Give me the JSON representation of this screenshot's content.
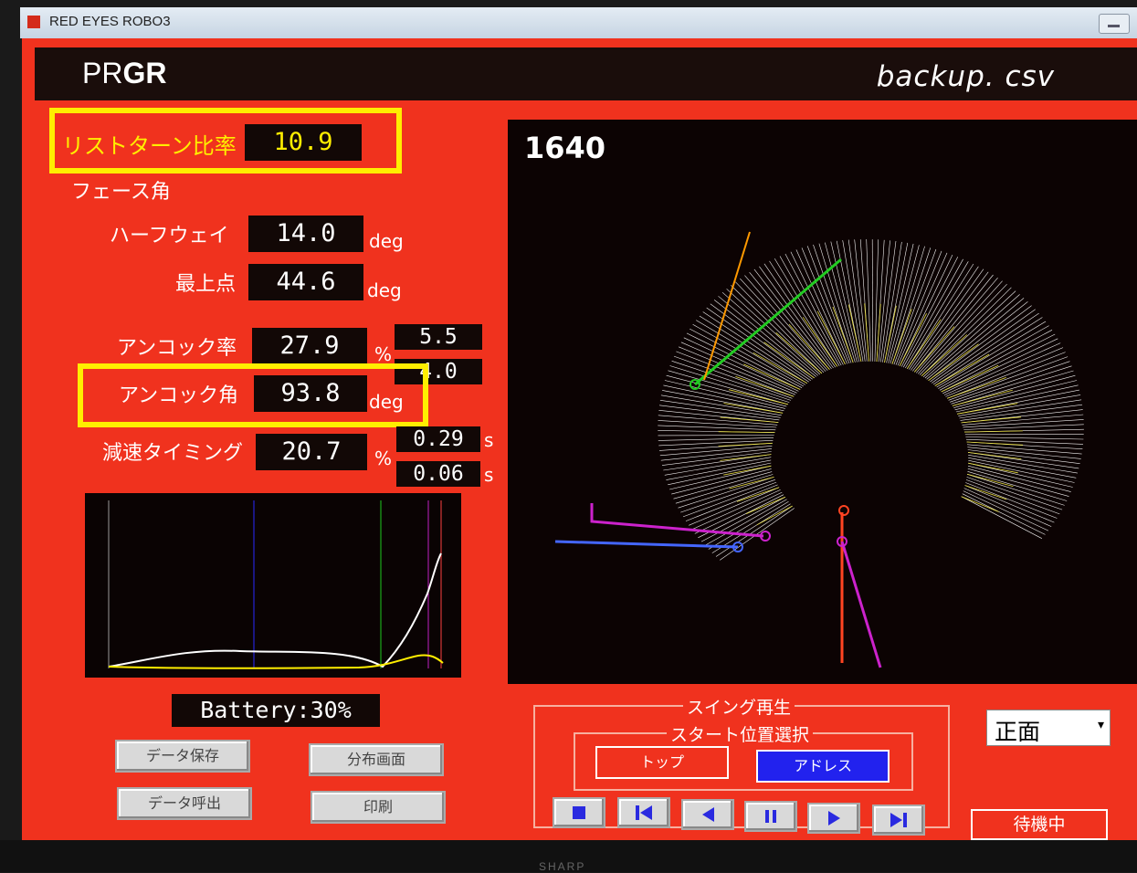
{
  "window": {
    "title": "RED EYES ROBO3"
  },
  "header": {
    "logo_pr": "PR",
    "logo_gr": "GR",
    "filename": "backup. csv"
  },
  "metrics": {
    "wrist_turn_label": "リストターン比率",
    "wrist_turn_value": "10.9",
    "face_angle_label": "フェース角",
    "halfway_label": "ハーフウェイ",
    "halfway_value": "14.0",
    "halfway_unit": "deg",
    "top_label": "最上点",
    "top_value": "44.6",
    "top_unit": "deg",
    "uncock_rate_label": "アンコック率",
    "uncock_rate_value": "27.9",
    "uncock_rate_unit": "%",
    "uncock_rate_side1": "5.5",
    "uncock_rate_side2": "4.0",
    "uncock_angle_label": "アンコック角",
    "uncock_angle_value": "93.8",
    "uncock_angle_unit": "deg",
    "decel_label": "減速タイミング",
    "decel_value": "20.7",
    "decel_unit": "%",
    "decel_side1": "0.29",
    "decel_side1_unit": "s",
    "decel_side2": "0.06",
    "decel_side2_unit": "s"
  },
  "battery": {
    "text": "Battery:30%"
  },
  "buttons": {
    "save": "データ保存",
    "distribution": "分布画面",
    "load": "データ呼出",
    "print": "印刷"
  },
  "visualization": {
    "frame_number": "1640"
  },
  "playback": {
    "group_title": "スイング再生",
    "start_group_title": "スタート位置選択",
    "top_button": "トップ",
    "address_button": "アドレス",
    "controls": [
      "stop-icon",
      "skip-start-icon",
      "step-back-icon",
      "pause-icon",
      "play-icon",
      "skip-end-icon"
    ]
  },
  "view_select": {
    "value": "正面"
  },
  "status": {
    "text": "待機中"
  },
  "monitor": {
    "brand": "SHARP"
  },
  "colors": {
    "background_red": "#f0321e",
    "highlight": "#ffee00",
    "panel_dark": "#120806",
    "address_blue": "#2222ee"
  }
}
